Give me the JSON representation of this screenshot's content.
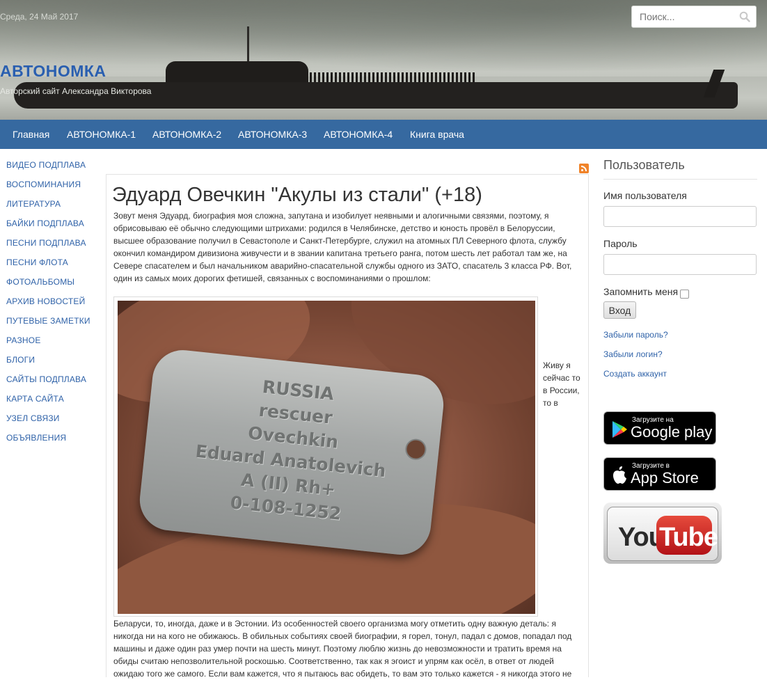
{
  "header": {
    "date": "Среда, 24 Май 2017",
    "site_title": "АВТОНОМКА",
    "site_description": "Авторский сайт Александра Викторова",
    "search_placeholder": "Поиск..."
  },
  "nav": {
    "items": [
      "Главная",
      "АВТОНОМКА-1",
      "АВТОНОМКА-2",
      "АВТОНОМКА-3",
      "АВТОНОМКА-4",
      "Книга врача"
    ]
  },
  "left_menu": {
    "items": [
      "ВИДЕО ПОДПЛАВА",
      "ВОСПОМИНАНИЯ",
      "ЛИТЕРАТУРА",
      "БАЙКИ ПОДПЛАВА",
      "ПЕСНИ ПОДПЛАВА",
      "ПЕСНИ ФЛОТА",
      "ФОТОАЛЬБОМЫ",
      "АРХИВ НОВОСТЕЙ",
      "ПУТЕВЫЕ ЗАМЕТКИ",
      "РАЗНОЕ",
      "БЛОГИ",
      "САЙТЫ ПОДПЛАВА",
      "КАРТА САЙТА",
      "УЗЕЛ СВЯЗИ",
      "ОБЪЯВЛЕНИЯ"
    ]
  },
  "article": {
    "title": "Эдуард Овечкин \"Акулы из стали\" (+18)",
    "intro": "Зовут меня Эдуард, биография моя сложна, запутана и изобилует неявными и алогичными связями, поэтому, я обрисовываю её обычно следующими штрихами: родился в Челябинске, детство и юность провёл в Белоруссии, высшее образование получил в Севастополе и Санкт-Петербурге, служил на атомных ПЛ Северного флота, службу окончил командиром дивизиона живучести и в звании капитана третьего ранга, потом шесть лет работал там же, на Севере спасателем и был начальником аварийно-спасательной службы одного из ЗАТО, спасатель 3 класса РФ. Вот, один из самых моих дорогих фетишей, связанных с воспоминаниями о прошлом:",
    "tag_lines": [
      "RUSSIA",
      "rescuer",
      "Ovechkin",
      "Eduard Anatolevich",
      "A (II) Rh+",
      "0-108-1252"
    ],
    "aside": "Живу я сейчас то в России, то в",
    "continuation": "Беларуси, то, иногда, даже и в Эстонии. Из особенностей своего организма могу отметить одну важную деталь: я никогда ни на кого не обижаюсь. В обильных событиях своей биографии, я горел, тонул, падал с домов, попадал под машины и даже один раз умер почти на шесть минут. Поэтому люблю жизнь до невозможности и тратить время на обиды считаю непозволительной роскошью. Соответственно, так как я эгоист и упрям как осёл, в ответ от людей ожидаю того же самого. Если вам кажется, что я пытаюсь вас обидеть, то вам это только кажется - я никогда этого не"
  },
  "login": {
    "heading": "Пользователь",
    "username_label": "Имя пользователя",
    "password_label": "Пароль",
    "remember_label": "Запомнить меня",
    "submit_label": "Вход",
    "forgot_password": "Забыли пароль?",
    "forgot_login": "Забыли логин?",
    "create_account": "Создать аккаунт"
  },
  "badges": {
    "google_small": "Загрузите на",
    "google_big": "Google play",
    "apple_small": "Загрузите в",
    "apple_big": "App Store",
    "youtube_you": "You",
    "youtube_tube": "Tube"
  },
  "colors": {
    "nav_bg": "#3669a0",
    "link": "#2f62a8",
    "title_blue": "#2a5fb0"
  }
}
